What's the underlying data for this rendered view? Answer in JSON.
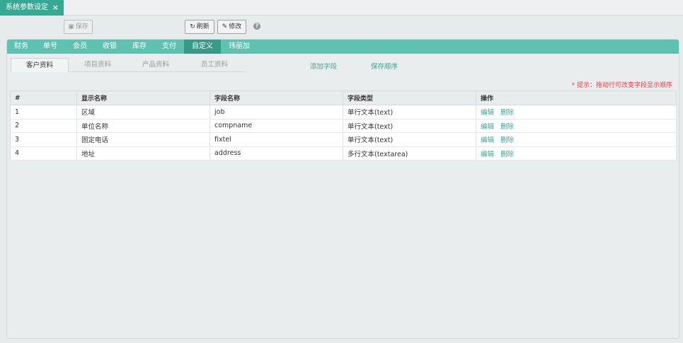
{
  "window_tab": {
    "title": "系统参数设定",
    "close": "×"
  },
  "toolbar": {
    "save_label": "保存",
    "refresh_label": "刷新",
    "modify_label": "修改",
    "help": "?"
  },
  "nav": {
    "items": [
      "财务",
      "单号",
      "会员",
      "收银",
      "库存",
      "支付",
      "自定义",
      "玮丽加"
    ],
    "active": "自定义"
  },
  "sub_tabs": {
    "items": [
      "客户资料",
      "项目资料",
      "产品资料",
      "员工资料"
    ],
    "active": "客户资料"
  },
  "actions": {
    "add_field": "添加字段",
    "save_order": "保存顺序"
  },
  "tip": "* 提示：拖动行可改变字段显示顺序",
  "table": {
    "headers": [
      "#",
      "显示名称",
      "字段名称",
      "字段类型",
      "操作"
    ],
    "rows": [
      {
        "num": "1",
        "display": "区域",
        "field": "job",
        "type": "单行文本(text)"
      },
      {
        "num": "2",
        "display": "单位名称",
        "field": "compname",
        "type": "单行文本(text)"
      },
      {
        "num": "3",
        "display": "固定电话",
        "field": "fixtel",
        "type": "单行文本(text)"
      },
      {
        "num": "4",
        "display": "地址",
        "field": "address",
        "type": "多行文本(textarea)"
      }
    ],
    "edit_label": "编辑",
    "delete_label": "删除"
  },
  "colors": {
    "accent": "#35a994",
    "nav_bg": "#5fc2b0",
    "nav_active": "#3a9a88",
    "tip": "#e0434b"
  }
}
